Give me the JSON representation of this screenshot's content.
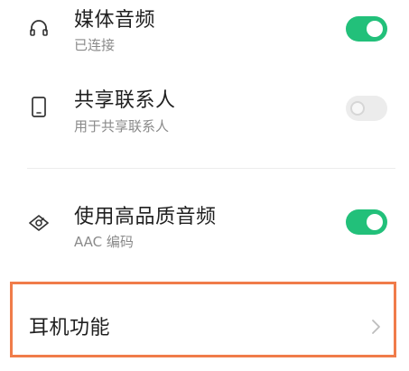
{
  "settings": {
    "media_audio": {
      "title": "媒体音频",
      "subtitle": "已连接",
      "icon": "headphones-icon",
      "enabled": true
    },
    "contact_sharing": {
      "title": "共享联系人",
      "subtitle": "用于共享联系人",
      "icon": "phone-icon",
      "enabled": false
    },
    "hq_audio": {
      "title": "使用高品质音频",
      "subtitle": "AAC 编码",
      "icon": "hq-audio-icon",
      "enabled": true
    },
    "earphone_functions": {
      "title": "耳机功能",
      "icon": "chevron-right-icon"
    }
  },
  "colors": {
    "toggle_on": "#22c07a",
    "toggle_off": "#ececec",
    "highlight_border": "#f07c4a"
  }
}
